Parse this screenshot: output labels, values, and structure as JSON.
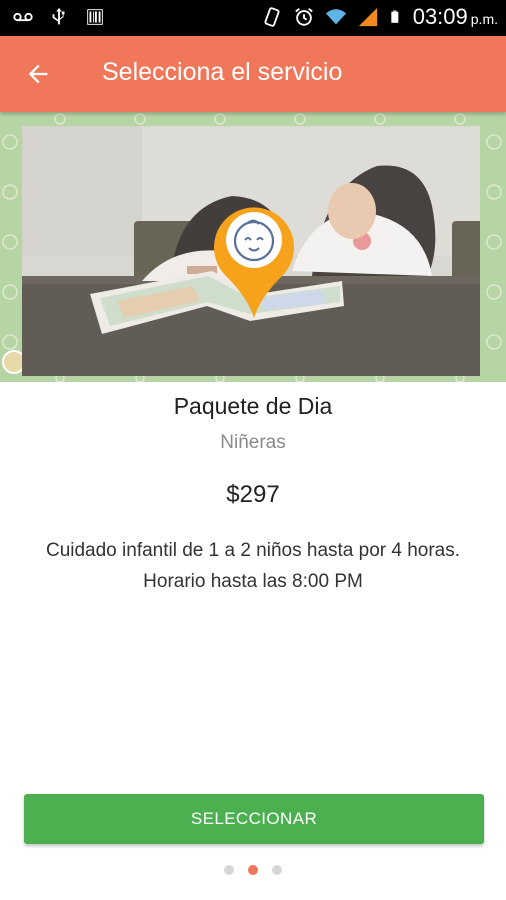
{
  "status_bar": {
    "time": "03:09",
    "ampm": "p.m.",
    "icons": [
      "voicemail-icon",
      "usb-icon",
      "barcode-icon",
      "vibrate-icon",
      "alarm-icon",
      "wifi-icon",
      "signal-icon",
      "battery-icon"
    ]
  },
  "app_bar": {
    "title": "Selecciona el servicio",
    "back_icon": "arrow-left-icon",
    "background": "#f0775a"
  },
  "hero": {
    "pin_icon": "baby-face-icon",
    "pin_color": "#f7a21b"
  },
  "service": {
    "name": "Paquete de Dia",
    "category": "Niñeras",
    "price": "$297",
    "description": "Cuidado infantil de 1 a 2 niños hasta por 4 horas. Horario hasta las 8:00 PM"
  },
  "actions": {
    "select_label": "SELECCIONAR",
    "select_color": "#4caf50"
  },
  "pager": {
    "count": 3,
    "active_index": 1
  }
}
